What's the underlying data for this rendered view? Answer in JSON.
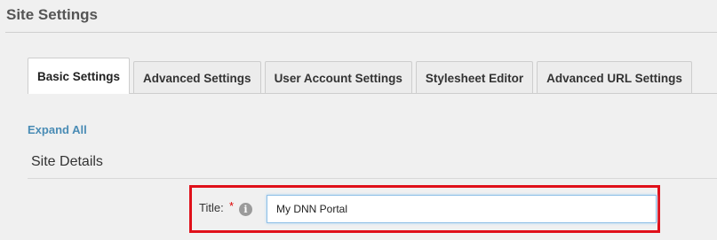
{
  "page": {
    "title": "Site Settings"
  },
  "tabs": [
    {
      "label": "Basic Settings",
      "active": true
    },
    {
      "label": "Advanced Settings",
      "active": false
    },
    {
      "label": "User Account Settings",
      "active": false
    },
    {
      "label": "Stylesheet Editor",
      "active": false
    },
    {
      "label": "Advanced URL Settings",
      "active": false
    }
  ],
  "actions": {
    "expand_all": "Expand All"
  },
  "section": {
    "title": "Site Details",
    "fields": {
      "title": {
        "label": "Title:",
        "required_marker": "*",
        "info_icon": "info-icon",
        "value": "My DNN Portal"
      }
    }
  },
  "colors": {
    "highlight_border": "#e0101a",
    "link": "#4a8cb5",
    "required": "#dd0000"
  }
}
